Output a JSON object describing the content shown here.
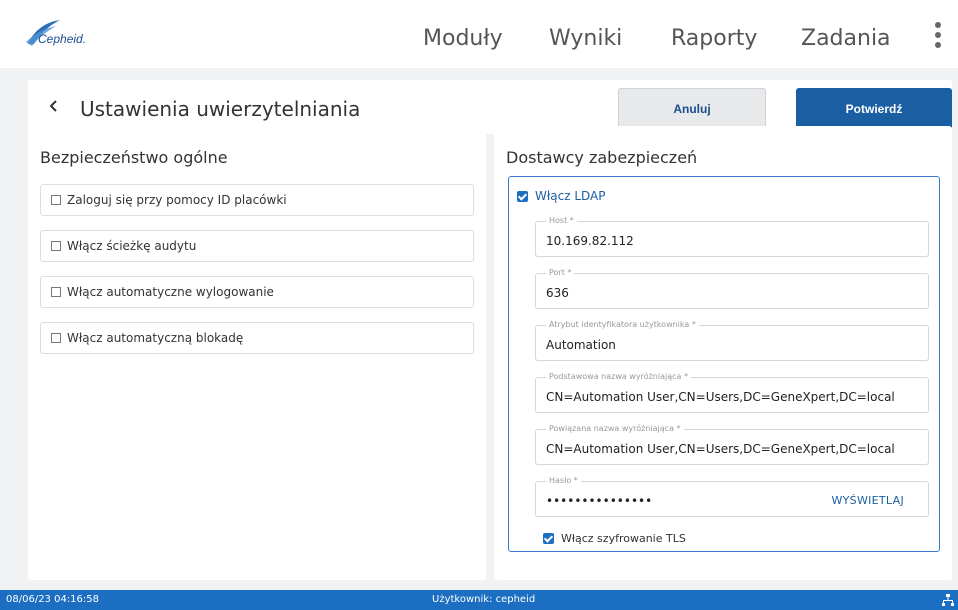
{
  "app": {
    "logo_text": "Cepheid."
  },
  "nav": {
    "items": [
      "Moduły",
      "Wyniki",
      "Raporty",
      "Zadania"
    ]
  },
  "header": {
    "title": "Ustawienia uwierzytelniania",
    "cancel_label": "Anuluj",
    "confirm_label": "Potwierdź"
  },
  "general_security": {
    "title": "Bezpieczeństwo ogólne",
    "options": [
      {
        "label": "Zaloguj się przy pomocy ID placówki",
        "checked": false
      },
      {
        "label": "Włącz ścieżkę audytu",
        "checked": false
      },
      {
        "label": "Włącz automatyczne wylogowanie",
        "checked": false
      },
      {
        "label": "Włącz automatyczną blokadę",
        "checked": false
      }
    ]
  },
  "security_providers": {
    "title": "Dostawcy zabezpieczeń",
    "ldap_label": "Włącz LDAP",
    "ldap_enabled": true,
    "fields": {
      "host": {
        "label": "Host *",
        "value": "10.169.82.112"
      },
      "port": {
        "label": "Port *",
        "value": "636"
      },
      "user_id_attribute": {
        "label": "Atrybut identyfikatora użytkownika *",
        "value": "Automation"
      },
      "base_dn": {
        "label": "Podstawowa nazwa wyróżniająca *",
        "value": "CN=Automation User,CN=Users,DC=GeneXpert,DC=local"
      },
      "bind_dn": {
        "label": "Powiązana nazwa wyróżniająca *",
        "value": "CN=Automation User,CN=Users,DC=GeneXpert,DC=local"
      },
      "password": {
        "label": "Hasło *",
        "value": "•••••••••••••••",
        "reveal_label": "WYŚWIETLAJ"
      }
    },
    "tls_label": "Włącz szyfrowanie TLS",
    "tls_enabled": true
  },
  "status_bar": {
    "datetime": "08/06/23 04:16:58",
    "user": "Użytkownik: cepheid"
  },
  "colors": {
    "primary": "#1b5fa3",
    "accent": "#1b6ec2",
    "background": "#f1f2f4"
  }
}
